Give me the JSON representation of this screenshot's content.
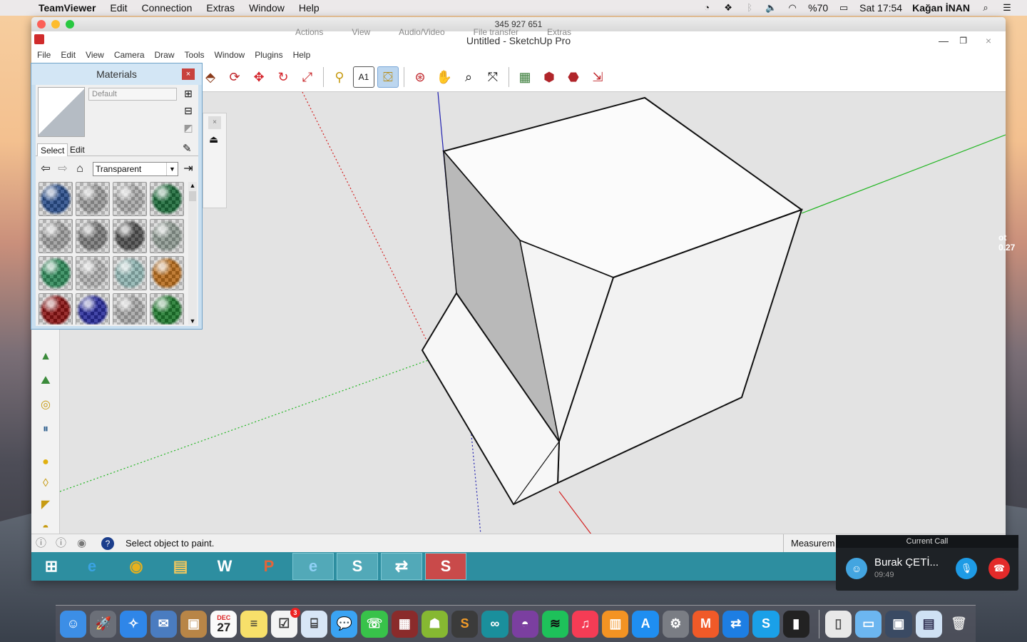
{
  "menubar": {
    "app": "TeamViewer",
    "items": [
      "Edit",
      "Connection",
      "Extras",
      "Window",
      "Help"
    ],
    "battery": "%70",
    "clock": "Sat 17:54",
    "user": "Kağan İNAN"
  },
  "teamviewer": {
    "session_id": "345 927 651",
    "toolbar": [
      "Actions",
      "View",
      "Audio/Video",
      "File transfer",
      "Extras"
    ]
  },
  "sketchup": {
    "title": "Untitled - SketchUp Pro",
    "menus": [
      "File",
      "Edit",
      "View",
      "Camera",
      "Draw",
      "Tools",
      "Window",
      "Plugins",
      "Help"
    ],
    "status": "Select object to paint.",
    "measurements_label": "Measurem"
  },
  "materials": {
    "title": "Materials",
    "name_value": "Default",
    "tab_select": "Select",
    "tab_edit": "Edit",
    "library": "Transparent",
    "close": "×"
  },
  "swatch_colors": [
    "#2b4f8c",
    "#9a9a9a",
    "#a8a8a8",
    "#1c6b3a",
    "#9c9c9c",
    "#7a7a7a",
    "#505050",
    "#8e9a92",
    "#2f8a5a",
    "#b0b0b0",
    "#8fb5b2",
    "#b86c1c",
    "#8b1414",
    "#2a2d9c",
    "#a6a6a6",
    "#1f7a2e"
  ],
  "call": {
    "header": "Current Call",
    "name": "Burak ÇETİ...",
    "time": "09:49"
  },
  "colors": {
    "axis_red": "#d42020",
    "axis_green": "#1fb51f",
    "axis_blue": "#2020b0",
    "taskbar": "#2d8ea0",
    "call_mute": "#1e9be5",
    "call_hangup": "#e32a2a"
  },
  "dock_calendar": {
    "month": "DEC",
    "day": "27"
  },
  "dock_badge": "3",
  "edge_text": [
    "ot",
    "0.27"
  ]
}
